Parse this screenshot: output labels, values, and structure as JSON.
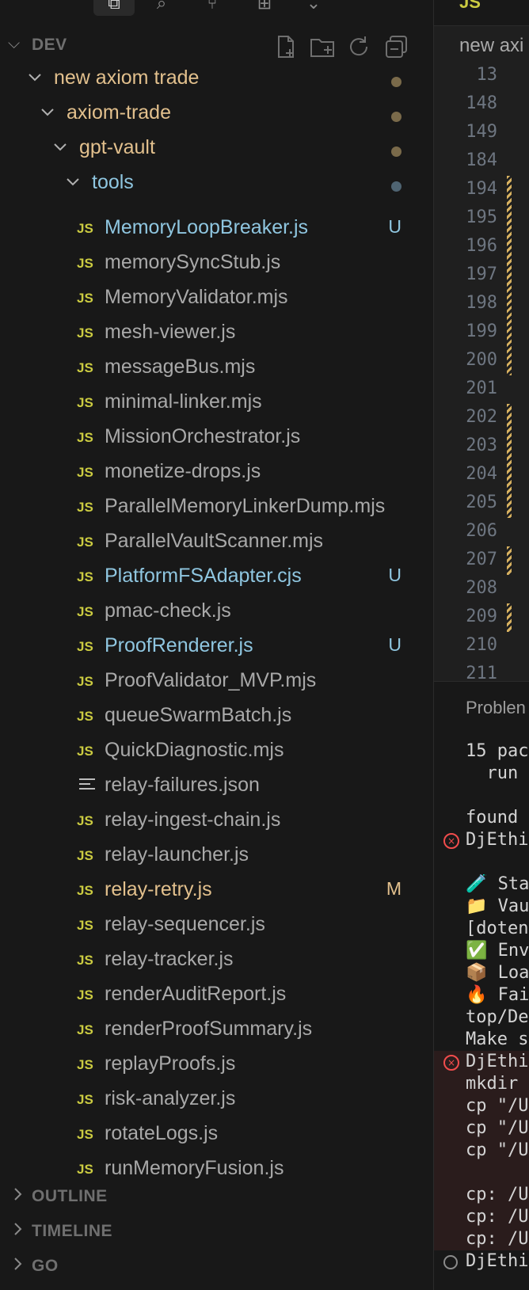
{
  "explorer": {
    "section_title": "DEV",
    "tree": [
      {
        "label": "new axiom trade",
        "dot_color": "#7a6a4a"
      },
      {
        "label": "axiom-trade",
        "dot_color": "#7a6a4a"
      },
      {
        "label": "gpt-vault",
        "dot_color": "#7a6a4a"
      },
      {
        "label": "tools",
        "dot_color": "#4f6472"
      }
    ],
    "files": [
      {
        "name": "MemoryLoopBreaker.js",
        "type": "js",
        "status": "U"
      },
      {
        "name": "memorySyncStub.js",
        "type": "js",
        "status": ""
      },
      {
        "name": "MemoryValidator.mjs",
        "type": "js",
        "status": ""
      },
      {
        "name": "mesh-viewer.js",
        "type": "js",
        "status": ""
      },
      {
        "name": "messageBus.mjs",
        "type": "js",
        "status": ""
      },
      {
        "name": "minimal-linker.mjs",
        "type": "js",
        "status": ""
      },
      {
        "name": "MissionOrchestrator.js",
        "type": "js",
        "status": ""
      },
      {
        "name": "monetize-drops.js",
        "type": "js",
        "status": ""
      },
      {
        "name": "ParallelMemoryLinkerDump.mjs",
        "type": "js",
        "status": ""
      },
      {
        "name": "ParallelVaultScanner.mjs",
        "type": "js",
        "status": ""
      },
      {
        "name": "PlatformFSAdapter.cjs",
        "type": "js",
        "status": "U"
      },
      {
        "name": "pmac-check.js",
        "type": "js",
        "status": ""
      },
      {
        "name": "ProofRenderer.js",
        "type": "js",
        "status": "U"
      },
      {
        "name": "ProofValidator_MVP.mjs",
        "type": "js",
        "status": ""
      },
      {
        "name": "queueSwarmBatch.js",
        "type": "js",
        "status": ""
      },
      {
        "name": "QuickDiagnostic.mjs",
        "type": "js",
        "status": ""
      },
      {
        "name": "relay-failures.json",
        "type": "json",
        "status": ""
      },
      {
        "name": "relay-ingest-chain.js",
        "type": "js",
        "status": ""
      },
      {
        "name": "relay-launcher.js",
        "type": "js",
        "status": ""
      },
      {
        "name": "relay-retry.js",
        "type": "js",
        "status": "M"
      },
      {
        "name": "relay-sequencer.js",
        "type": "js",
        "status": ""
      },
      {
        "name": "relay-tracker.js",
        "type": "js",
        "status": ""
      },
      {
        "name": "renderAuditReport.js",
        "type": "js",
        "status": ""
      },
      {
        "name": "renderProofSummary.js",
        "type": "js",
        "status": ""
      },
      {
        "name": "replayProofs.js",
        "type": "js",
        "status": ""
      },
      {
        "name": "risk-analyzer.js",
        "type": "js",
        "status": ""
      },
      {
        "name": "rotateLogs.js",
        "type": "js",
        "status": ""
      },
      {
        "name": "runMemoryFusion.js",
        "type": "js",
        "status": ""
      }
    ],
    "js_badge": "JS",
    "bottom_sections": [
      "OUTLINE",
      "TIMELINE",
      "GO"
    ]
  },
  "editor": {
    "tab_label": "JS",
    "breadcrumb": "new axi",
    "line_numbers": [
      "13",
      "148",
      "149",
      "184",
      "194",
      "195",
      "196",
      "197",
      "198",
      "199",
      "200",
      "201",
      "202",
      "203",
      "204",
      "205",
      "206",
      "207",
      "208",
      "209",
      "210",
      "211"
    ]
  },
  "panel": {
    "tab_label": "Problen",
    "lines": [
      "15 pac",
      "  run",
      "",
      "found",
      "DjEthi",
      "",
      "🧪 Sta",
      "📁 Vau",
      "[doten",
      "✅ Env",
      "📦 Loa",
      "🔥 Fai",
      "top/De",
      "Make s",
      "DjEthi",
      "mkdir",
      "cp \"/U",
      "cp \"/U",
      "cp \"/U",
      "",
      "cp: /U",
      "cp: /U",
      "cp: /U",
      "DjEthi"
    ]
  }
}
